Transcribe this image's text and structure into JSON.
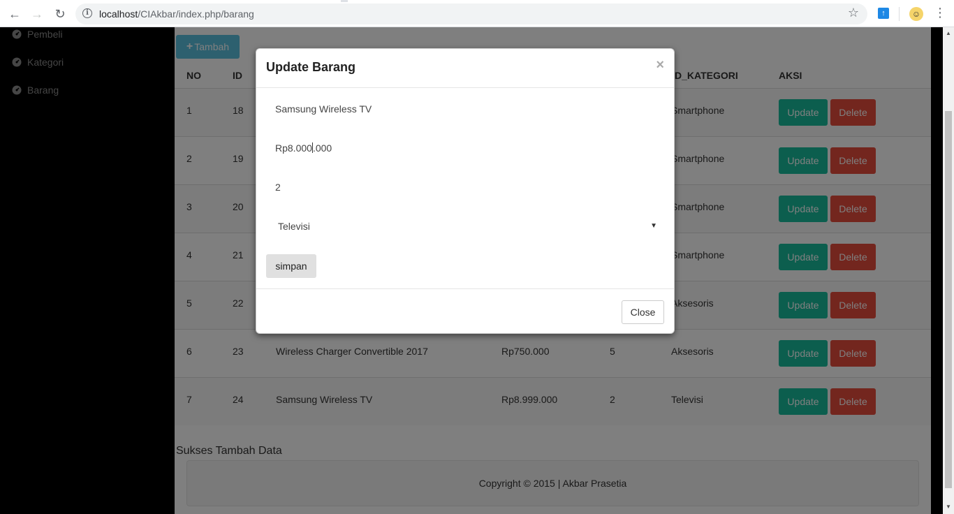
{
  "browser": {
    "url_host": "localhost",
    "url_path": "/CIAkbar/index.php/barang"
  },
  "sidebar": {
    "items": [
      {
        "label": "Pembeli",
        "icon": "dashboard-icon"
      },
      {
        "label": "Kategori",
        "icon": "dashboard-icon"
      },
      {
        "label": "Barang",
        "icon": "dashboard-icon"
      }
    ]
  },
  "toolbar": {
    "add_label": "Tambah"
  },
  "table": {
    "headers": {
      "no": "NO",
      "id": "ID",
      "kategori": "D_KATEGORI",
      "aksi": "AKSI"
    },
    "update_label": "Update",
    "delete_label": "Delete",
    "rows": [
      {
        "no": "1",
        "id": "18",
        "name": "",
        "price": "",
        "qty": "",
        "kategori": "Smartphone"
      },
      {
        "no": "2",
        "id": "19",
        "name": "",
        "price": "",
        "qty": "",
        "kategori": "Smartphone"
      },
      {
        "no": "3",
        "id": "20",
        "name": "",
        "price": "",
        "qty": "",
        "kategori": "Smartphone"
      },
      {
        "no": "4",
        "id": "21",
        "name": "",
        "price": "",
        "qty": "",
        "kategori": "Smartphone"
      },
      {
        "no": "5",
        "id": "22",
        "name": "",
        "price": "",
        "qty": "",
        "kategori": "Aksesoris"
      },
      {
        "no": "6",
        "id": "23",
        "name": "Wireless Charger Convertible 2017",
        "price": "Rp750.000",
        "qty": "5",
        "kategori": "Aksesoris"
      },
      {
        "no": "7",
        "id": "24",
        "name": "Samsung Wireless TV",
        "price": "Rp8.999.000",
        "qty": "2",
        "kategori": "Televisi"
      }
    ]
  },
  "status_message": "Sukses Tambah Data",
  "footer_text": "Copyright © 2015 | Akbar Prasetia",
  "modal": {
    "title": "Update Barang",
    "close_symbol": "×",
    "name_value": "Samsung Wireless TV",
    "price_value_before_cursor": "Rp8.000",
    "price_value_after_cursor": ".000",
    "qty_value": "2",
    "category_selected": "Televisi",
    "save_label": "simpan",
    "close_label": "Close"
  }
}
